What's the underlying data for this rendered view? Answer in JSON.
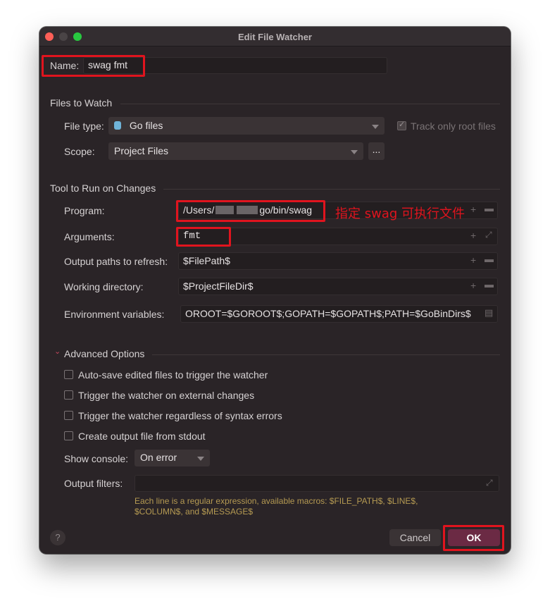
{
  "window": {
    "title": "Edit File Watcher"
  },
  "name_field": {
    "label": "Name:",
    "value": "swag fmt"
  },
  "files_to_watch": {
    "title": "Files to Watch",
    "file_type_label": "File type:",
    "file_type_value": "Go files",
    "track_only_root_label": "Track only root files",
    "scope_label": "Scope:",
    "scope_value": "Project Files",
    "scope_more": "..."
  },
  "tool": {
    "title": "Tool to Run on Changes",
    "program_label": "Program:",
    "program_value_start": "/Users/",
    "program_value_end": "go/bin/swag",
    "program_annotation": "指定 swag 可执行文件",
    "arguments_label": "Arguments:",
    "arguments_value": "fmt",
    "output_paths_label": "Output paths to refresh:",
    "output_paths_value": "$FilePath$",
    "working_dir_label": "Working directory:",
    "working_dir_value": "$ProjectFileDir$",
    "env_label": "Environment variables:",
    "env_value": "OROOT=$GOROOT$;GOPATH=$GOPATH$;PATH=$GoBinDirs$"
  },
  "advanced": {
    "title": "Advanced Options",
    "options": [
      "Auto-save edited files to trigger the watcher",
      "Trigger the watcher on external changes",
      "Trigger the watcher regardless of syntax errors",
      "Create output file from stdout"
    ],
    "show_console_label": "Show console:",
    "show_console_value": "On error",
    "output_filters_label": "Output filters:",
    "note_line1": "Each line is a regular expression, available macros: $FILE_PATH$, $LINE$,",
    "note_line2": "$COLUMN$, and $MESSAGE$"
  },
  "footer": {
    "help": "?",
    "cancel": "Cancel",
    "ok": "OK"
  },
  "colors": {
    "accent": "#e0141e",
    "ok_button": "#6b2a44",
    "window_bg": "#2a2427"
  },
  "icons": [
    "go-file-icon",
    "folder-icon",
    "plus-icon",
    "expand-icon",
    "document-icon",
    "chevron-down-icon",
    "help-icon"
  ]
}
